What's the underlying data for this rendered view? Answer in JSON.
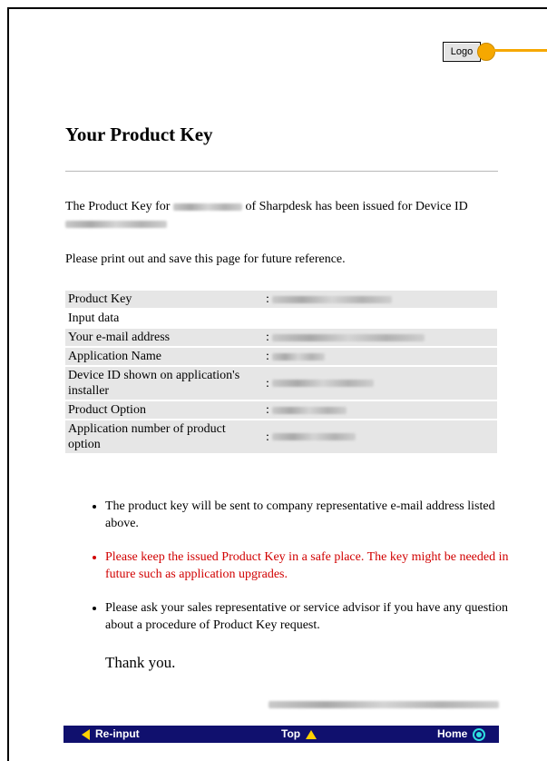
{
  "logo": {
    "label": "Logo"
  },
  "heading": "Your Product Key",
  "intro": {
    "part1": "The Product Key for",
    "part2": "of Sharpdesk has been issued for Device",
    "part3": "ID"
  },
  "print_note": "Please print out and save this page for future reference.",
  "table": {
    "separator": ":",
    "rows": [
      {
        "label": "Product Key"
      },
      {
        "label": "Input data"
      },
      {
        "label": "Your e-mail address"
      },
      {
        "label": "Application Name"
      },
      {
        "label": "Device ID shown on application's installer"
      },
      {
        "label": "Product Option"
      },
      {
        "label": "Application number of product option"
      }
    ]
  },
  "notes": [
    "The product key will be sent to company representative e-mail address listed above.",
    "Please keep the issued Product Key in a safe place. The key might be needed in future such as application upgrades.",
    "Please ask your sales representative or service advisor if you have any question about a procedure of Product Key request."
  ],
  "thanks": "Thank you.",
  "navbar": {
    "back": "Re-input",
    "top": "Top",
    "home": "Home"
  },
  "colors": {
    "navbar_bg": "#10106e",
    "warning_text": "#d10000",
    "callout": "#f6a800"
  }
}
